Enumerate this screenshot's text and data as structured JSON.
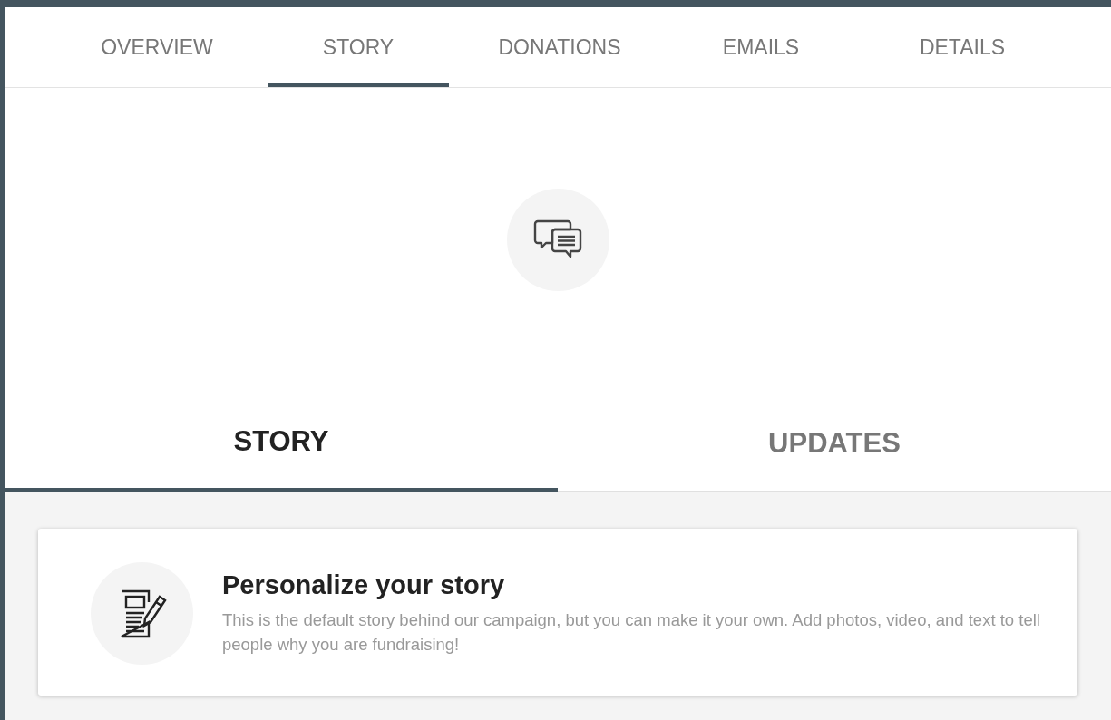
{
  "tabs": [
    {
      "label": "OVERVIEW",
      "selected": false
    },
    {
      "label": "STORY",
      "selected": true
    },
    {
      "label": "DONATIONS",
      "selected": false
    },
    {
      "label": "EMAILS",
      "selected": false
    },
    {
      "label": "DETAILS",
      "selected": false
    }
  ],
  "subtabs": [
    {
      "label": "STORY",
      "selected": true
    },
    {
      "label": "UPDATES",
      "selected": false
    }
  ],
  "info_card": {
    "title": "Personalize your story",
    "text": "This is the default story behind our campaign, but you can make it your own. Add photos, video, and text to tell people why you are fundraising!"
  }
}
